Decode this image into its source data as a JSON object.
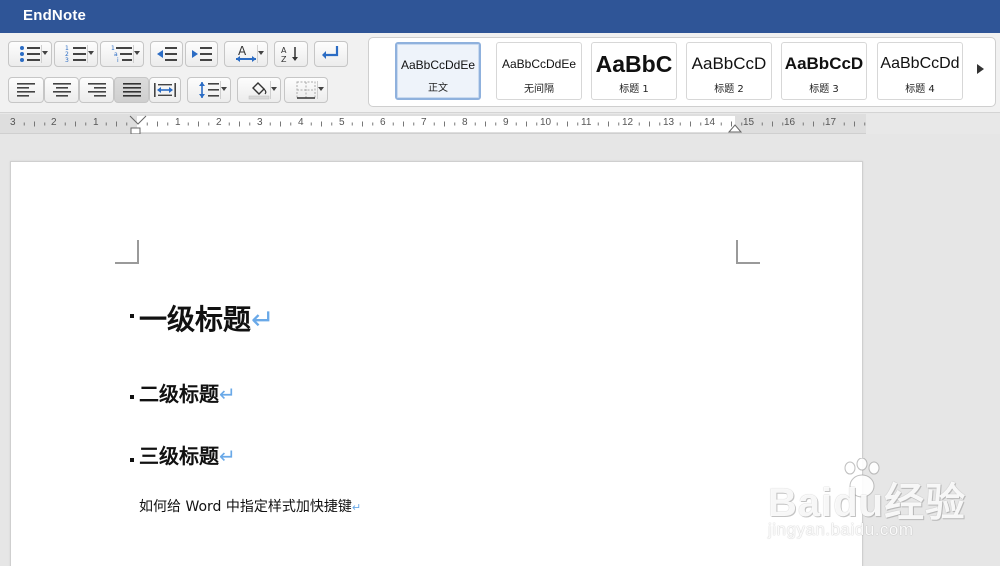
{
  "window": {
    "title": "EndNote"
  },
  "ribbon": {
    "paragraph_tools": [
      "bulleted-list",
      "numbered-list",
      "multilevel-list",
      "decrease-indent",
      "increase-indent",
      "text-direction",
      "sort",
      "paragraph-mark",
      "align-left",
      "align-center",
      "align-right",
      "justify",
      "distributed",
      "line-spacing",
      "shading",
      "borders"
    ],
    "styles": [
      {
        "preview": "AaBbCcDdEe",
        "label": "正文",
        "active": true
      },
      {
        "preview": "AaBbCcDdEe",
        "label": "无间隔",
        "active": false
      },
      {
        "preview": "AaBbC",
        "label": "标题 1",
        "active": false
      },
      {
        "preview": "AaBbCcD",
        "label": "标题 2",
        "active": false
      },
      {
        "preview": "AaBbCcD",
        "label": "标题 3",
        "active": false
      },
      {
        "preview": "AaBbCcDd",
        "label": "标题 4",
        "active": false
      }
    ]
  },
  "ruler": {
    "left_numbers": [
      "3",
      "2",
      "1"
    ],
    "right_numbers": [
      "1",
      "2",
      "3",
      "4",
      "5",
      "6",
      "7",
      "8",
      "9",
      "10",
      "11",
      "12",
      "13",
      "14",
      "15",
      "16",
      "17"
    ]
  },
  "document": {
    "heading1": "一级标题",
    "heading2": "二级标题",
    "heading3": "三级标题",
    "body": "如何给 Word 中指定样式加快捷键",
    "paragraph_mark": "↵"
  },
  "watermark": {
    "brand": "Baidu经验",
    "sub": "jingyan.baidu.com"
  },
  "colors": {
    "titlebar": "#2f5597",
    "paragraph_mark": "#6aa9e8",
    "accent_arrow": "#3b7fd8"
  }
}
